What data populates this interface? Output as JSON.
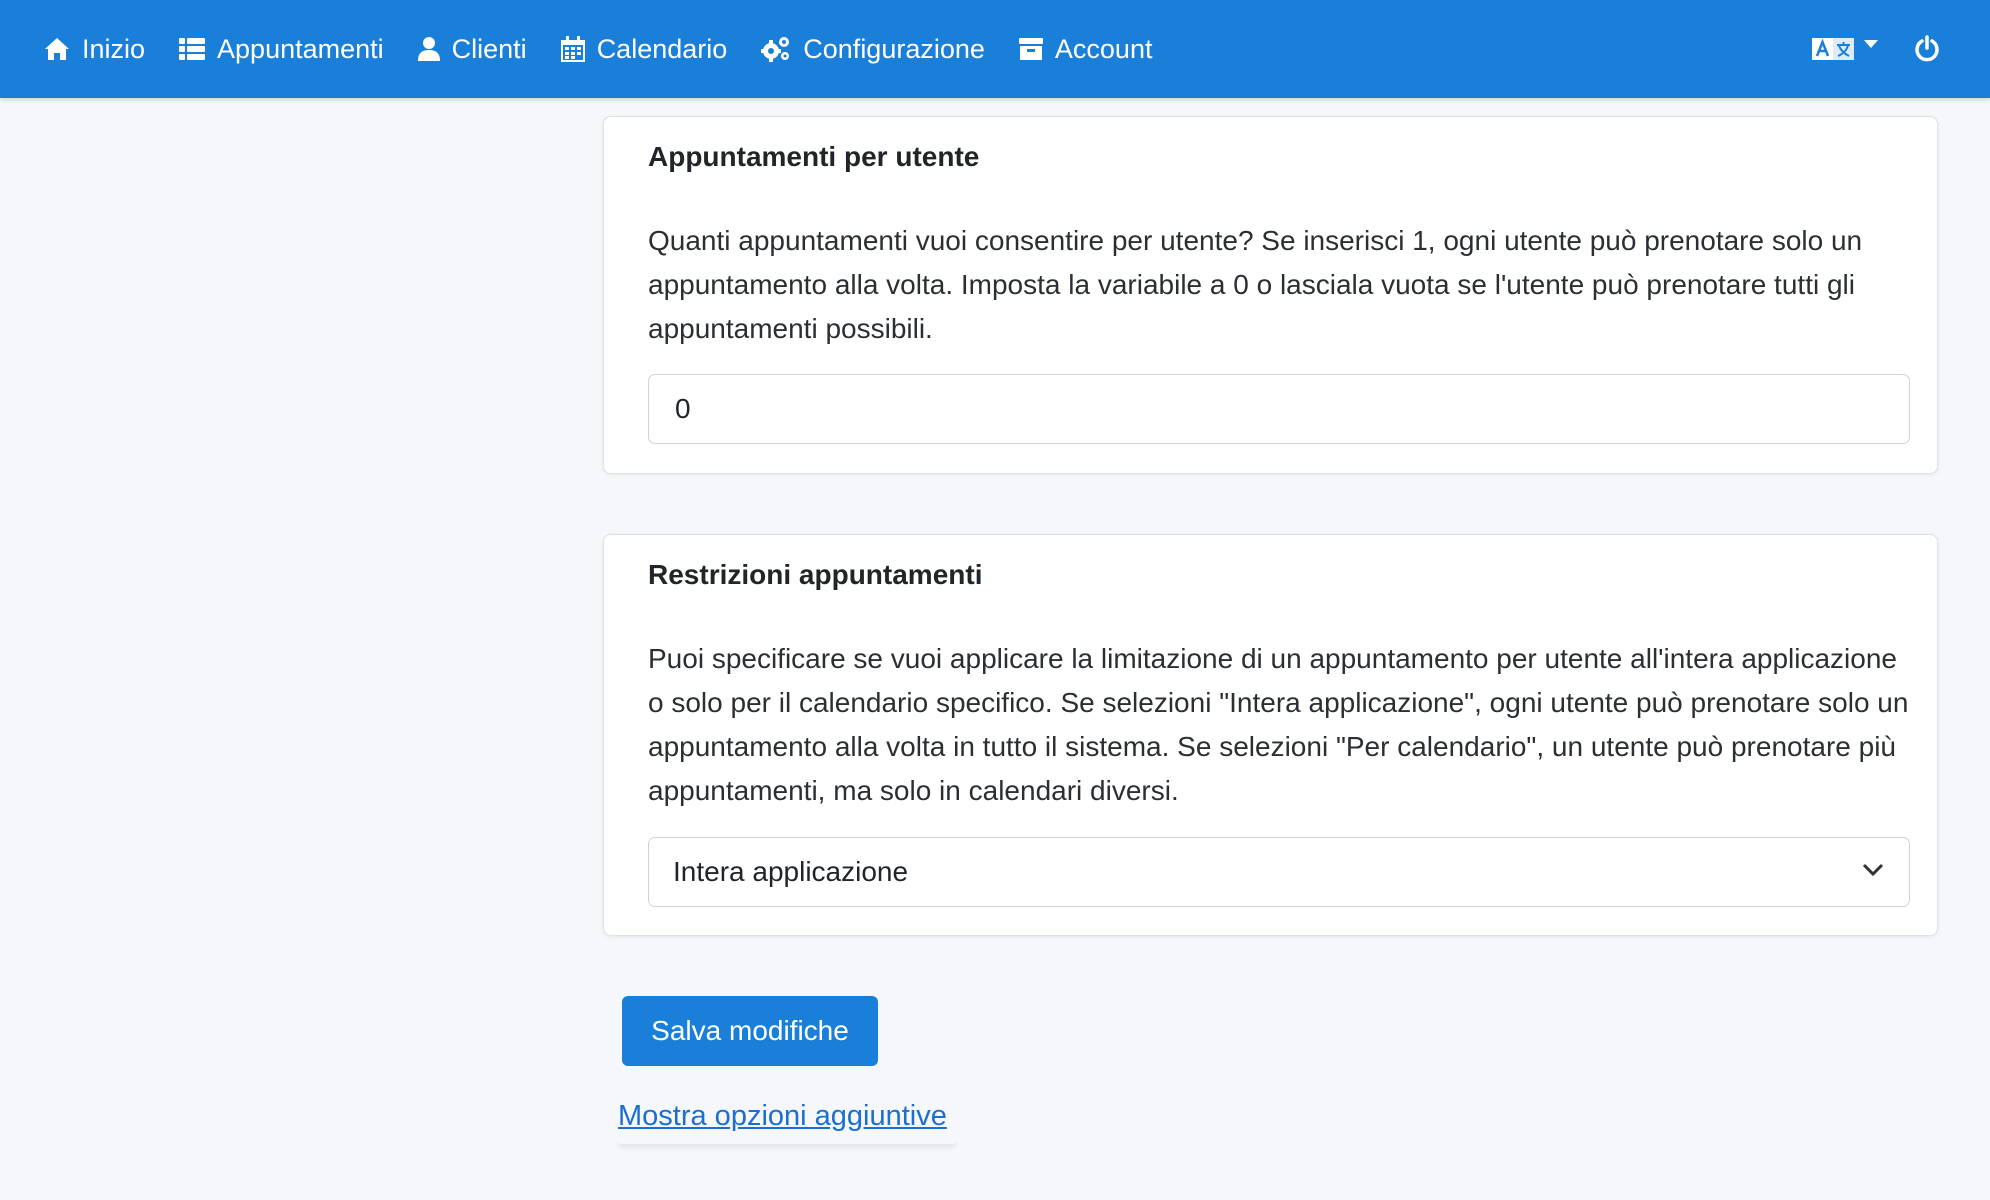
{
  "nav": {
    "items": [
      {
        "label": "Inizio",
        "icon": "home-icon"
      },
      {
        "label": "Appuntamenti",
        "icon": "list-icon"
      },
      {
        "label": "Clienti",
        "icon": "user-icon"
      },
      {
        "label": "Calendario",
        "icon": "calendar-icon"
      },
      {
        "label": "Configurazione",
        "icon": "gears-icon"
      },
      {
        "label": "Account",
        "icon": "archive-icon"
      }
    ],
    "language_icon": "language-icon",
    "power_icon": "power-icon"
  },
  "appointments_per_user": {
    "title": "Appuntamenti per utente",
    "description": "Quanti appuntamenti vuoi consentire per utente? Se inserisci 1, ogni utente può prenotare solo un appuntamento alla volta. Imposta la variabile a 0 o lasciala vuota se l'utente può prenotare tutti gli appuntamenti possibili.",
    "value": "0"
  },
  "appointment_restrictions": {
    "title": "Restrizioni appuntamenti",
    "description": "Puoi specificare se vuoi applicare la limitazione di un appuntamento per utente all'intera applicazione o solo per il calendario specifico. Se selezioni \"Intera applicazione\", ogni utente può prenotare solo un appuntamento alla volta in tutto il sistema. Se selezioni \"Per calendario\", un utente può prenotare più appuntamenti, ma solo in calendari diversi.",
    "selected": "Intera applicazione"
  },
  "actions": {
    "save_label": "Salva modifiche",
    "more_options_label": "Mostra opzioni aggiuntive"
  },
  "colors": {
    "primary": "#1a7fd9",
    "background": "#f5f7fa"
  }
}
